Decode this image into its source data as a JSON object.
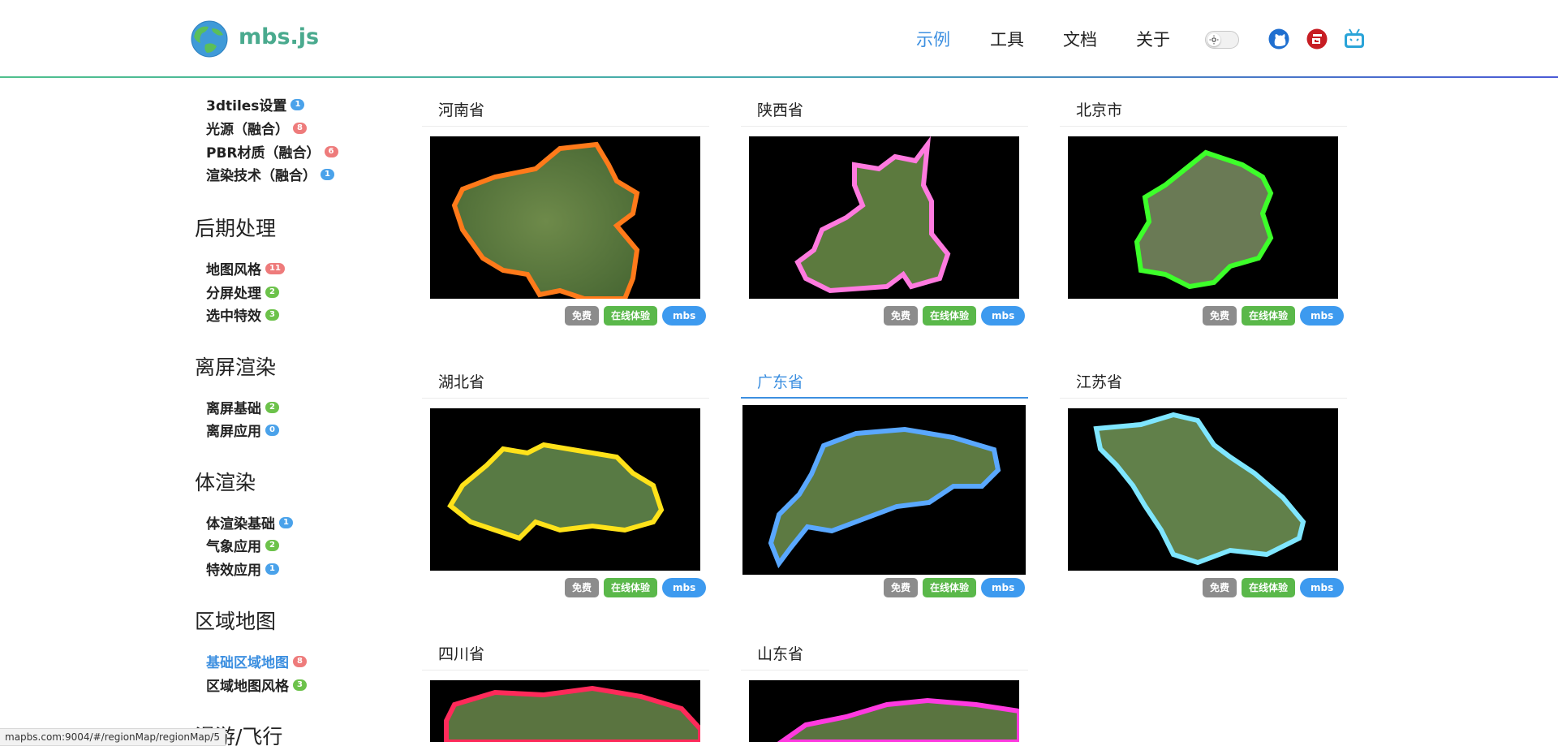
{
  "header": {
    "logo_text": "mbs.js",
    "nav": [
      {
        "label": "示例",
        "active": true
      },
      {
        "label": "工具",
        "active": false
      },
      {
        "label": "文档",
        "active": false
      },
      {
        "label": "关于",
        "active": false
      }
    ],
    "icons": [
      "theme-toggle-icon",
      "github-icon",
      "gitee-icon",
      "bilibili-icon"
    ]
  },
  "sidebar": {
    "top_items": [
      {
        "label": "3dtiles设置",
        "count": "1",
        "color": "#4aa2ea"
      },
      {
        "label": "光源（融合）",
        "count": "8",
        "color": "#ee7b7b"
      },
      {
        "label": "PBR材质（融合）",
        "count": "6",
        "color": "#ee7b7b"
      },
      {
        "label": "渲染技术（融合）",
        "count": "1",
        "color": "#4aa2ea"
      }
    ],
    "groups": [
      {
        "title": "后期处理",
        "items": [
          {
            "label": "地图风格",
            "count": "11",
            "color": "#ee7b7b"
          },
          {
            "label": "分屏处理",
            "count": "2",
            "color": "#6cc24a"
          },
          {
            "label": "选中特效",
            "count": "3",
            "color": "#6cc24a"
          }
        ]
      },
      {
        "title": "离屏渲染",
        "items": [
          {
            "label": "离屏基础",
            "count": "2",
            "color": "#6cc24a"
          },
          {
            "label": "离屏应用",
            "count": "0",
            "color": "#4aa2ea"
          }
        ]
      },
      {
        "title": "体渲染",
        "items": [
          {
            "label": "体渲染基础",
            "count": "1",
            "color": "#4aa2ea"
          },
          {
            "label": "气象应用",
            "count": "2",
            "color": "#6cc24a"
          },
          {
            "label": "特效应用",
            "count": "1",
            "color": "#4aa2ea"
          }
        ]
      },
      {
        "title": "区域地图",
        "items": [
          {
            "label": "基础区域地图",
            "count": "8",
            "color": "#ee7b7b",
            "active": true
          },
          {
            "label": "区域地图风格",
            "count": "3",
            "color": "#6cc24a"
          }
        ]
      },
      {
        "title": "漫游/飞行",
        "items": []
      }
    ]
  },
  "cards": [
    {
      "title": "河南省",
      "glow": "#ff7a1a"
    },
    {
      "title": "陕西省",
      "glow": "#ff7adf"
    },
    {
      "title": "北京市",
      "glow": "#3dff2a"
    },
    {
      "title": "湖北省",
      "glow": "#ffe21a"
    },
    {
      "title": "广东省",
      "glow": "#5aa8ff",
      "hover": true
    },
    {
      "title": "江苏省",
      "glow": "#7fe6ff"
    },
    {
      "title": "四川省",
      "glow": "#ff2a5a"
    },
    {
      "title": "山东省",
      "glow": "#ff3ae0"
    }
  ],
  "tags": {
    "free": "免费",
    "online": "在线体验",
    "mbs": "mbs"
  },
  "status_url": "mapbs.com:9004/#/regionMap/regionMap/5"
}
